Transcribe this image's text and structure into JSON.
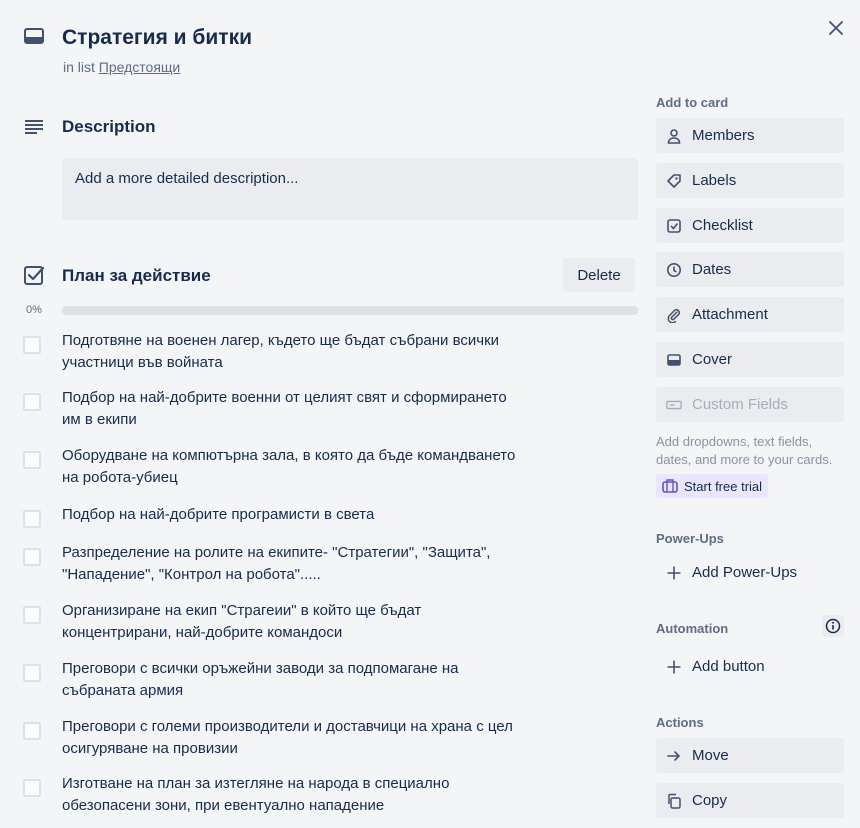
{
  "header": {
    "title": "Стратегия и битки",
    "in_list_prefix": "in list",
    "list_name": "Предстоящи"
  },
  "description": {
    "title": "Description",
    "placeholder": "Add a more detailed description..."
  },
  "checklist": {
    "title": "План за действие",
    "delete_label": "Delete",
    "progress_label": "0%",
    "progress_fraction": 0,
    "items": [
      {
        "line1": "Подготвяне на военен лагер, където ще бъдат събрани всички",
        "line2": "участници във войната"
      },
      {
        "line1": "Подбор на най-добрите военни от целият свят и сформирането",
        "line2": "им в екипи"
      },
      {
        "line1": "Оборудване на компютърна зала, в която да бъде командването",
        "line2": "на робота-убиец"
      },
      {
        "line1": "Подбор на най-добрите програмисти в света",
        "line2": ""
      },
      {
        "line1": "Разпределение на ролите на екипите- \"Стратегии\", \"Защита\",",
        "line2": "\"Нападение\", \"Контрол на робота\"....."
      },
      {
        "line1": "Организиране на екип \"Страгеии\" в който ще бъдат",
        "line2": "концентрирани, най-добрите командоси"
      },
      {
        "line1": "Преговори с всички оръжейни заводи за подпомагане на",
        "line2": "събраната армия"
      },
      {
        "line1": "Преговори с големи производители и доставчици на храна с цел",
        "line2": "осигуряване на провизии"
      },
      {
        "line1": "Изготване на план за изтегляне на народа в специално",
        "line2": "обезопасени зони, при евентуално нападение"
      }
    ]
  },
  "sidebar": {
    "add_to_card": "Add to card",
    "members": "Members",
    "labels": "Labels",
    "checklist": "Checklist",
    "dates": "Dates",
    "attachment": "Attachment",
    "cover": "Cover",
    "custom_fields": "Custom Fields",
    "custom_fields_note_1": "Add dropdowns, text fields,",
    "custom_fields_note_2": "dates, and more to your cards.",
    "start_trial": "Start free trial",
    "power_ups_heading": "Power-Ups",
    "add_power_ups": "Add Power-Ups",
    "automation_heading": "Automation",
    "add_button": "Add button",
    "actions_heading": "Actions",
    "move": "Move",
    "copy": "Copy"
  }
}
